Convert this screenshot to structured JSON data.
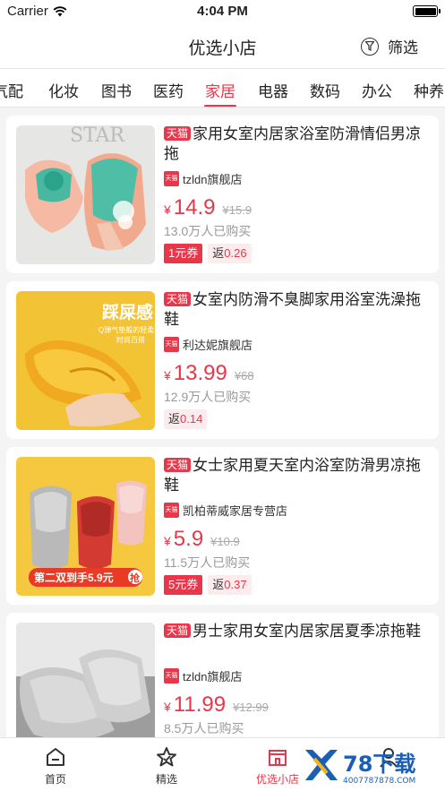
{
  "status_bar": {
    "carrier": "Carrier",
    "time": "4:04 PM"
  },
  "header": {
    "title": "优选小店",
    "filter_label": "筛选"
  },
  "tabs": [
    {
      "label": "电器"
    },
    {
      "label": "化妆"
    },
    {
      "label": "图书"
    },
    {
      "label": "医药"
    },
    {
      "label": "家居",
      "active": true
    },
    {
      "label": "电器"
    },
    {
      "label": "数码"
    },
    {
      "label": "办公"
    },
    {
      "label": "种养"
    }
  ],
  "tabs_partial": {
    "first_visible": "气配",
    "last_visible": "种养"
  },
  "products": [
    {
      "platform_tag": "天猫",
      "title": "家用女室内居家浴室防滑情侣男凉拖",
      "shop_logo": "天猫",
      "shop": "tzldn旗舰店",
      "currency": "¥",
      "price": "14.9",
      "original_price": "¥15.9",
      "sold": "13.0万人已购买",
      "coupon": "1元券",
      "rebate_label": "返",
      "rebate_value": "0.26"
    },
    {
      "platform_tag": "天猫",
      "title": "女室内防滑不臭脚家用浴室洗澡拖鞋",
      "shop_logo": "天猫",
      "shop": "利达妮旗舰店",
      "currency": "¥",
      "price": "13.99",
      "original_price": "¥68",
      "sold": "12.9万人已购买",
      "coupon": "",
      "rebate_label": "返",
      "rebate_value": "0.14",
      "image_text": {
        "headline": "踩屎感",
        "sub1": "Q弹气垫般的轻柔",
        "sub2": "时尚百搭"
      }
    },
    {
      "platform_tag": "天猫",
      "title": "女士家用夏天室内浴室防滑男凉拖鞋",
      "shop_logo": "天猫",
      "shop": "凯柏蒂威家居专营店",
      "currency": "¥",
      "price": "5.9",
      "original_price": "¥10.9",
      "sold": "11.5万人已购买",
      "coupon": "5元券",
      "rebate_label": "返",
      "rebate_value": "0.37",
      "image_text": {
        "banner": "第二双到手5.9元",
        "grab": "抢"
      }
    },
    {
      "platform_tag": "天猫",
      "title": "男士家用女室内居家居夏季凉拖鞋",
      "shop_logo": "天猫",
      "shop": "tzldn旗舰店",
      "currency": "¥",
      "price": "11.99",
      "original_price": "¥12.99",
      "sold": "8.5万人已购买",
      "coupon": "",
      "rebate_label": "",
      "rebate_value": ""
    }
  ],
  "bottom_nav": [
    {
      "label": "首页",
      "icon": "home-icon"
    },
    {
      "label": "精选",
      "icon": "star-icon"
    },
    {
      "label": "优选小店",
      "icon": "shop-icon",
      "active": true
    },
    {
      "label": "",
      "icon": "user-icon"
    }
  ],
  "watermark": {
    "text": "78下载",
    "url_text": "4007787878.COM"
  },
  "colors": {
    "accent": "#e8374a",
    "background": "#f4f4f4"
  }
}
